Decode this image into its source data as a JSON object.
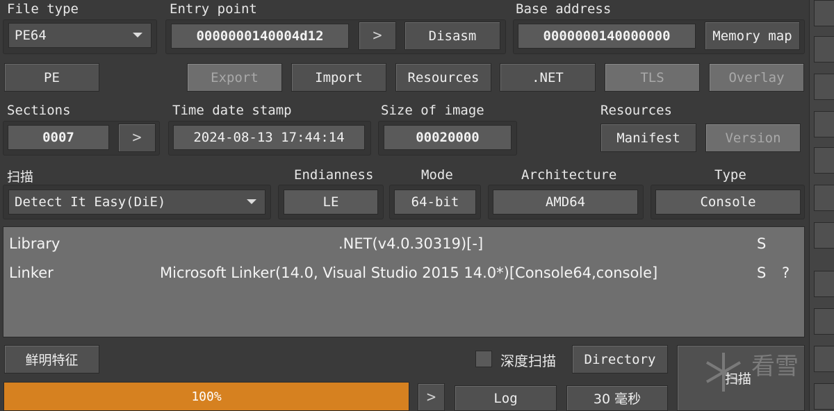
{
  "file_type": {
    "label": "File type",
    "value": "PE64"
  },
  "entry_point": {
    "label": "Entry point",
    "value": "0000000140004d12",
    "go": ">",
    "disasm": "Disasm"
  },
  "base_address": {
    "label": "Base address",
    "value": "0000000140000000",
    "memory_map": "Memory map"
  },
  "buttons_row": {
    "pe": "PE",
    "export": "Export",
    "import": "Import",
    "resources": "Resources",
    "net": ".NET",
    "tls": "TLS",
    "overlay": "Overlay"
  },
  "sections": {
    "label": "Sections",
    "value": "0007",
    "go": ">"
  },
  "time_date_stamp": {
    "label": "Time date stamp",
    "value": "2024-08-13 17:44:14"
  },
  "size_of_image": {
    "label": "Size of image",
    "value": "00020000"
  },
  "resources_panel": {
    "label": "Resources",
    "manifest": "Manifest",
    "version": "Version"
  },
  "scan": {
    "label": "扫描",
    "engine": "Detect It Easy(DiE)"
  },
  "endianness": {
    "label": "Endianness",
    "value": "LE"
  },
  "mode": {
    "label": "Mode",
    "value": "64-bit"
  },
  "architecture": {
    "label": "Architecture",
    "value": "AMD64"
  },
  "type": {
    "label": "Type",
    "value": "Console"
  },
  "results": [
    {
      "kind": "Library",
      "name": ".NET(v4.0.30319)[-]",
      "flag": "S",
      "extra": ""
    },
    {
      "kind": "Linker",
      "name": "Microsoft Linker(14.0, Visual Studio 2015 14.0*)[Console64,console]",
      "flag": "S",
      "extra": "?"
    }
  ],
  "bottom": {
    "signatures": "鲜明特征",
    "deep_scan": "深度扫描",
    "directory": "Directory",
    "scan_button": "扫描",
    "progress_text": "100%",
    "progress_value": 1.0,
    "log": "Log",
    "elapsed": "30 毫秒",
    "go": ">",
    "watermark": "看雪"
  },
  "side_strip": [
    "",
    "",
    "",
    "",
    "",
    "",
    "",
    "",
    "",
    "",
    "",
    "",
    ""
  ]
}
